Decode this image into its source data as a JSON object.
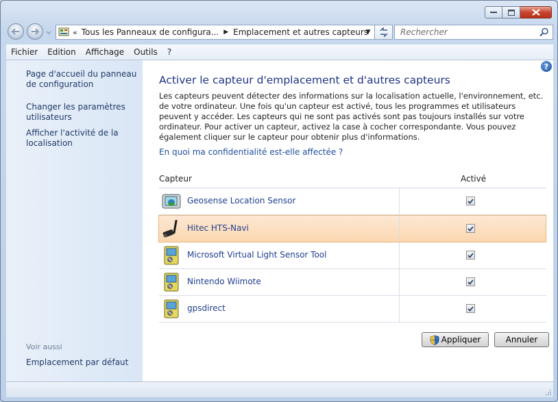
{
  "window": {
    "caption_buttons": [
      "minimize-icon",
      "maximize-icon",
      "close-icon"
    ]
  },
  "address_bar": {
    "chevron": "«",
    "crumbs": [
      "Tous les Panneaux de configura...",
      "Emplacement et autres capteurs"
    ],
    "search_placeholder": "Rechercher"
  },
  "menu": [
    "Fichier",
    "Edition",
    "Affichage",
    "Outils",
    "?"
  ],
  "sidebar": {
    "links": [
      "Page d'accueil du panneau de configuration",
      "Changer les paramètres utilisateurs",
      "Afficher l'activité de la localisation"
    ],
    "see_also_title": "Voir aussi",
    "see_also_link": "Emplacement par défaut"
  },
  "main": {
    "title": "Activer le capteur d'emplacement et d'autres capteurs",
    "description": "Les capteurs peuvent détecter des informations sur la localisation actuelle, l'environnement, etc. de votre ordinateur. Une fois qu'un capteur est activé, tous les programmes et utilisateurs peuvent y accéder. Les capteurs qui ne sont pas activés sont pas toujours installés sur votre ordinateur. Pour activer un capteur, activez la case à cocher correspondante. Vous pouvez également cliquer sur le capteur pour obtenir plus d'informations.",
    "privacy_link": "En quoi ma confidentialité est-elle affectée ?",
    "table": {
      "col_sensor": "Capteur",
      "col_active": "Activé",
      "rows": [
        {
          "name": "Geosense Location Sensor",
          "icon": "location-sensor-icon",
          "active": true
        },
        {
          "name": "Hitec HTS-Navi",
          "icon": "gps-antenna-icon",
          "active": true
        },
        {
          "name": "Microsoft Virtual Light Sensor Tool",
          "icon": "sensor-device-icon",
          "active": true
        },
        {
          "name": "Nintendo Wiimote",
          "icon": "sensor-device-icon",
          "active": true
        },
        {
          "name": "gpsdirect",
          "icon": "sensor-device-icon",
          "active": true
        }
      ],
      "selected_row": 1
    },
    "apply_label": "Appliquer",
    "cancel_label": "Annuler"
  },
  "help_label": "?"
}
